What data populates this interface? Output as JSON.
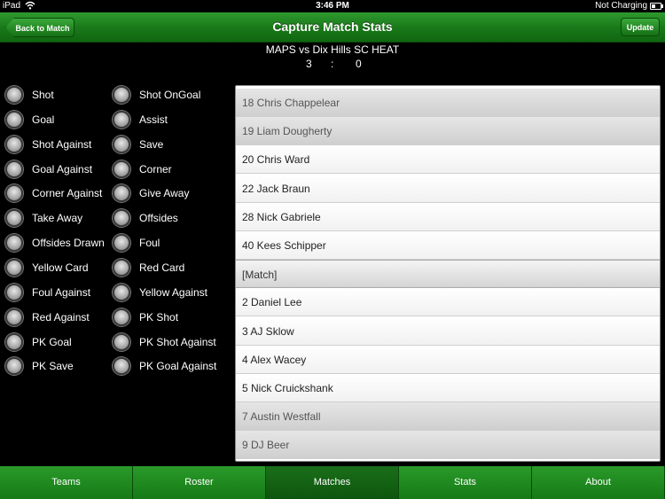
{
  "status_bar": {
    "device": "iPad",
    "time": "3:46 PM",
    "charging": "Not Charging"
  },
  "nav": {
    "back_label": "Back to Match",
    "title": "Capture Match Stats",
    "update_label": "Update"
  },
  "match": {
    "title": "MAPS vs Dix Hills SC HEAT",
    "home_score": "3",
    "separator": ":",
    "away_score": "0"
  },
  "options_left": [
    "Shot",
    "Goal",
    "Shot Against",
    "Goal Against",
    "Corner Against",
    "Take Away",
    "Offsides Drawn",
    "Yellow Card",
    "Foul Against",
    "Red Against",
    "PK Goal",
    "PK Save"
  ],
  "options_right": [
    "Shot OnGoal",
    "Assist",
    "Save",
    "Corner",
    "Give Away",
    "Offsides",
    "Foul",
    "Red Card",
    "Yellow Against",
    "PK Shot",
    "PK Shot Against",
    "PK Goal Against"
  ],
  "list": [
    {
      "label": "18 Chris Chappelear"
    },
    {
      "label": "19 Liam Dougherty"
    },
    {
      "label": "20 Chris Ward"
    },
    {
      "label": "22 Jack Braun"
    },
    {
      "label": "28 Nick Gabriele"
    },
    {
      "label": "40 Kees Schipper"
    },
    {
      "label": "[Match]"
    },
    {
      "label": "2 Daniel Lee"
    },
    {
      "label": "3 AJ Sklow"
    },
    {
      "label": "4 Alex Wacey"
    },
    {
      "label": "5 Nick Cruickshank"
    },
    {
      "label": "7 Austin Westfall"
    },
    {
      "label": "9 DJ Beer"
    }
  ],
  "tabs": [
    {
      "label": "Teams"
    },
    {
      "label": "Roster"
    },
    {
      "label": "Matches",
      "active": true
    },
    {
      "label": "Stats"
    },
    {
      "label": "About"
    }
  ],
  "colors": {
    "nav_green": "#1a7a1a",
    "tab_green": "#2a9a2a",
    "tab_active": "#0e560e"
  }
}
